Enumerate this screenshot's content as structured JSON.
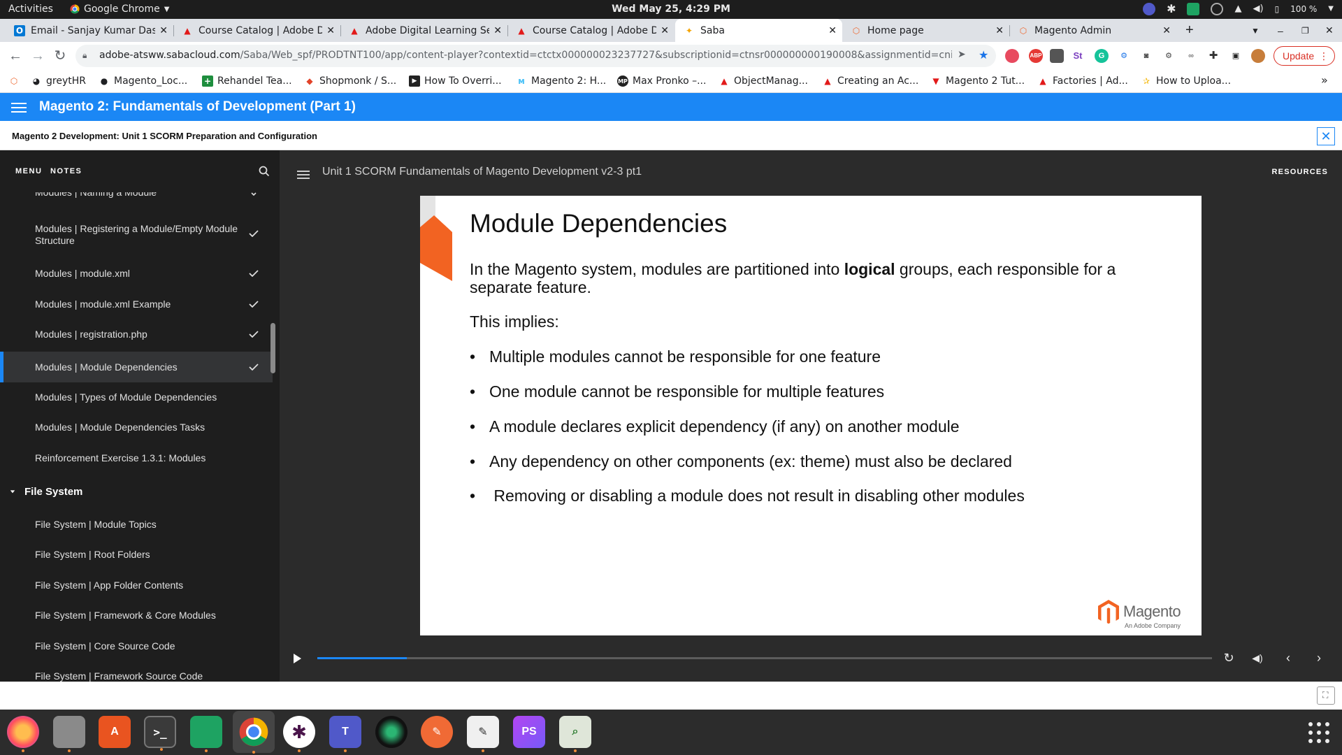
{
  "system": {
    "activities": "Activities",
    "app_name": "Google Chrome",
    "clock": "Wed May 25,  4:29 PM",
    "battery": "100 %"
  },
  "tabs": [
    {
      "title": "Email - Sanjay Kumar Das",
      "favicon": "outlook-icon",
      "color": "#0078d4"
    },
    {
      "title": "Course Catalog | Adobe D",
      "favicon": "adobe-icon",
      "color": "#e21a1a"
    },
    {
      "title": "Adobe Digital Learning Se",
      "favicon": "adobe-icon",
      "color": "#e21a1a"
    },
    {
      "title": "Course Catalog | Adobe D",
      "favicon": "adobe-icon",
      "color": "#e21a1a"
    },
    {
      "title": "Saba",
      "favicon": "saba-icon",
      "color": "#f4a300",
      "active": true
    },
    {
      "title": "Home page",
      "favicon": "magento-icon",
      "color": "#ee672f"
    },
    {
      "title": "Magento Admin",
      "favicon": "magento-icon",
      "color": "#ee672f"
    }
  ],
  "new_tab": "+",
  "address": {
    "host": "adobe-atsww.sabacloud.com",
    "path": "/Saba/Web_spf/PRODTNT100/app/content-player?contextid=ctctx000000023237727&subscriptionid=ctnsr000000000190008&assignmentid=cninv00000000007..."
  },
  "update_label": "Update",
  "bookmarks": [
    {
      "label": "",
      "icon": "magento-icon"
    },
    {
      "label": "greytHR",
      "icon": "greythr-icon"
    },
    {
      "label": "Magento_Loc...",
      "icon": "github-icon"
    },
    {
      "label": "Rehandel Tea...",
      "icon": "plus-square-icon"
    },
    {
      "label": "Shopmonk / S...",
      "icon": "gitlab-icon"
    },
    {
      "label": "How To Overri...",
      "icon": "video-icon"
    },
    {
      "label": "Magento 2: H...",
      "icon": "m-icon"
    },
    {
      "label": "Max Pronko –...",
      "icon": "mp-icon"
    },
    {
      "label": "ObjectManag...",
      "icon": "adobe-icon"
    },
    {
      "label": "Creating an Ac...",
      "icon": "adobe-icon"
    },
    {
      "label": "Magento 2 Tut...",
      "icon": "triangle-icon"
    },
    {
      "label": "Factories | Ad...",
      "icon": "adobe-icon"
    },
    {
      "label": "How to Uploa...",
      "icon": "star-icon"
    }
  ],
  "bookmarks_more": "»",
  "app": {
    "course_title": "Magento 2: Fundamentals of Development (Part 1)",
    "unit_title": "Magento 2 Development: Unit 1 SCORM Preparation and Configuration"
  },
  "sidebar": {
    "menu_tab": "MENU",
    "notes_tab": "NOTES",
    "items": [
      {
        "label": "Modules | Naming a Module",
        "checked": true
      },
      {
        "label": "Modules | Registering a Module/Empty Module Structure",
        "checked": true
      },
      {
        "label": "Modules | module.xml",
        "checked": true
      },
      {
        "label": "Modules | module.xml Example",
        "checked": true
      },
      {
        "label": "Modules | registration.php",
        "checked": true
      },
      {
        "label": "Modules | Module Dependencies",
        "checked": true,
        "active": true
      },
      {
        "label": "Modules | Types of Module Dependencies",
        "checked": false
      },
      {
        "label": "Modules | Module Dependencies Tasks",
        "checked": false
      },
      {
        "label": "Reinforcement Exercise 1.3.1: Modules",
        "checked": false
      }
    ],
    "section": "File System",
    "section_items": [
      {
        "label": "File System | Module Topics"
      },
      {
        "label": "File System | Root Folders"
      },
      {
        "label": "File System | App Folder Contents"
      },
      {
        "label": "File System | Framework & Core Modules"
      },
      {
        "label": "File System | Core Source Code"
      },
      {
        "label": "File System | Framework Source Code"
      }
    ]
  },
  "player": {
    "lesson_title": "Unit 1 SCORM Fundamentals of Magento Development v2-3 pt1",
    "resources": "RESOURCES",
    "progress": 0.1
  },
  "slide": {
    "title": "Module Dependencies",
    "intro_pre": "In the Magento system, modules are partitioned into ",
    "intro_bold": "logical",
    "intro_post": " groups, each responsible for a separate feature.",
    "implies": "This implies:",
    "bullets": [
      "Multiple modules cannot be responsible for one feature",
      "One module cannot be responsible for multiple features",
      "A module declares explicit dependency (if any) on another module",
      "Any dependency on other components (ex: theme) must also be declared",
      " Removing or disabling a module does not result in disabling other modules"
    ],
    "logo_text": "Magento",
    "logo_sub": "An Adobe Company"
  },
  "colors": {
    "accent": "#1b87f5",
    "magento_orange": "#ee672f"
  }
}
